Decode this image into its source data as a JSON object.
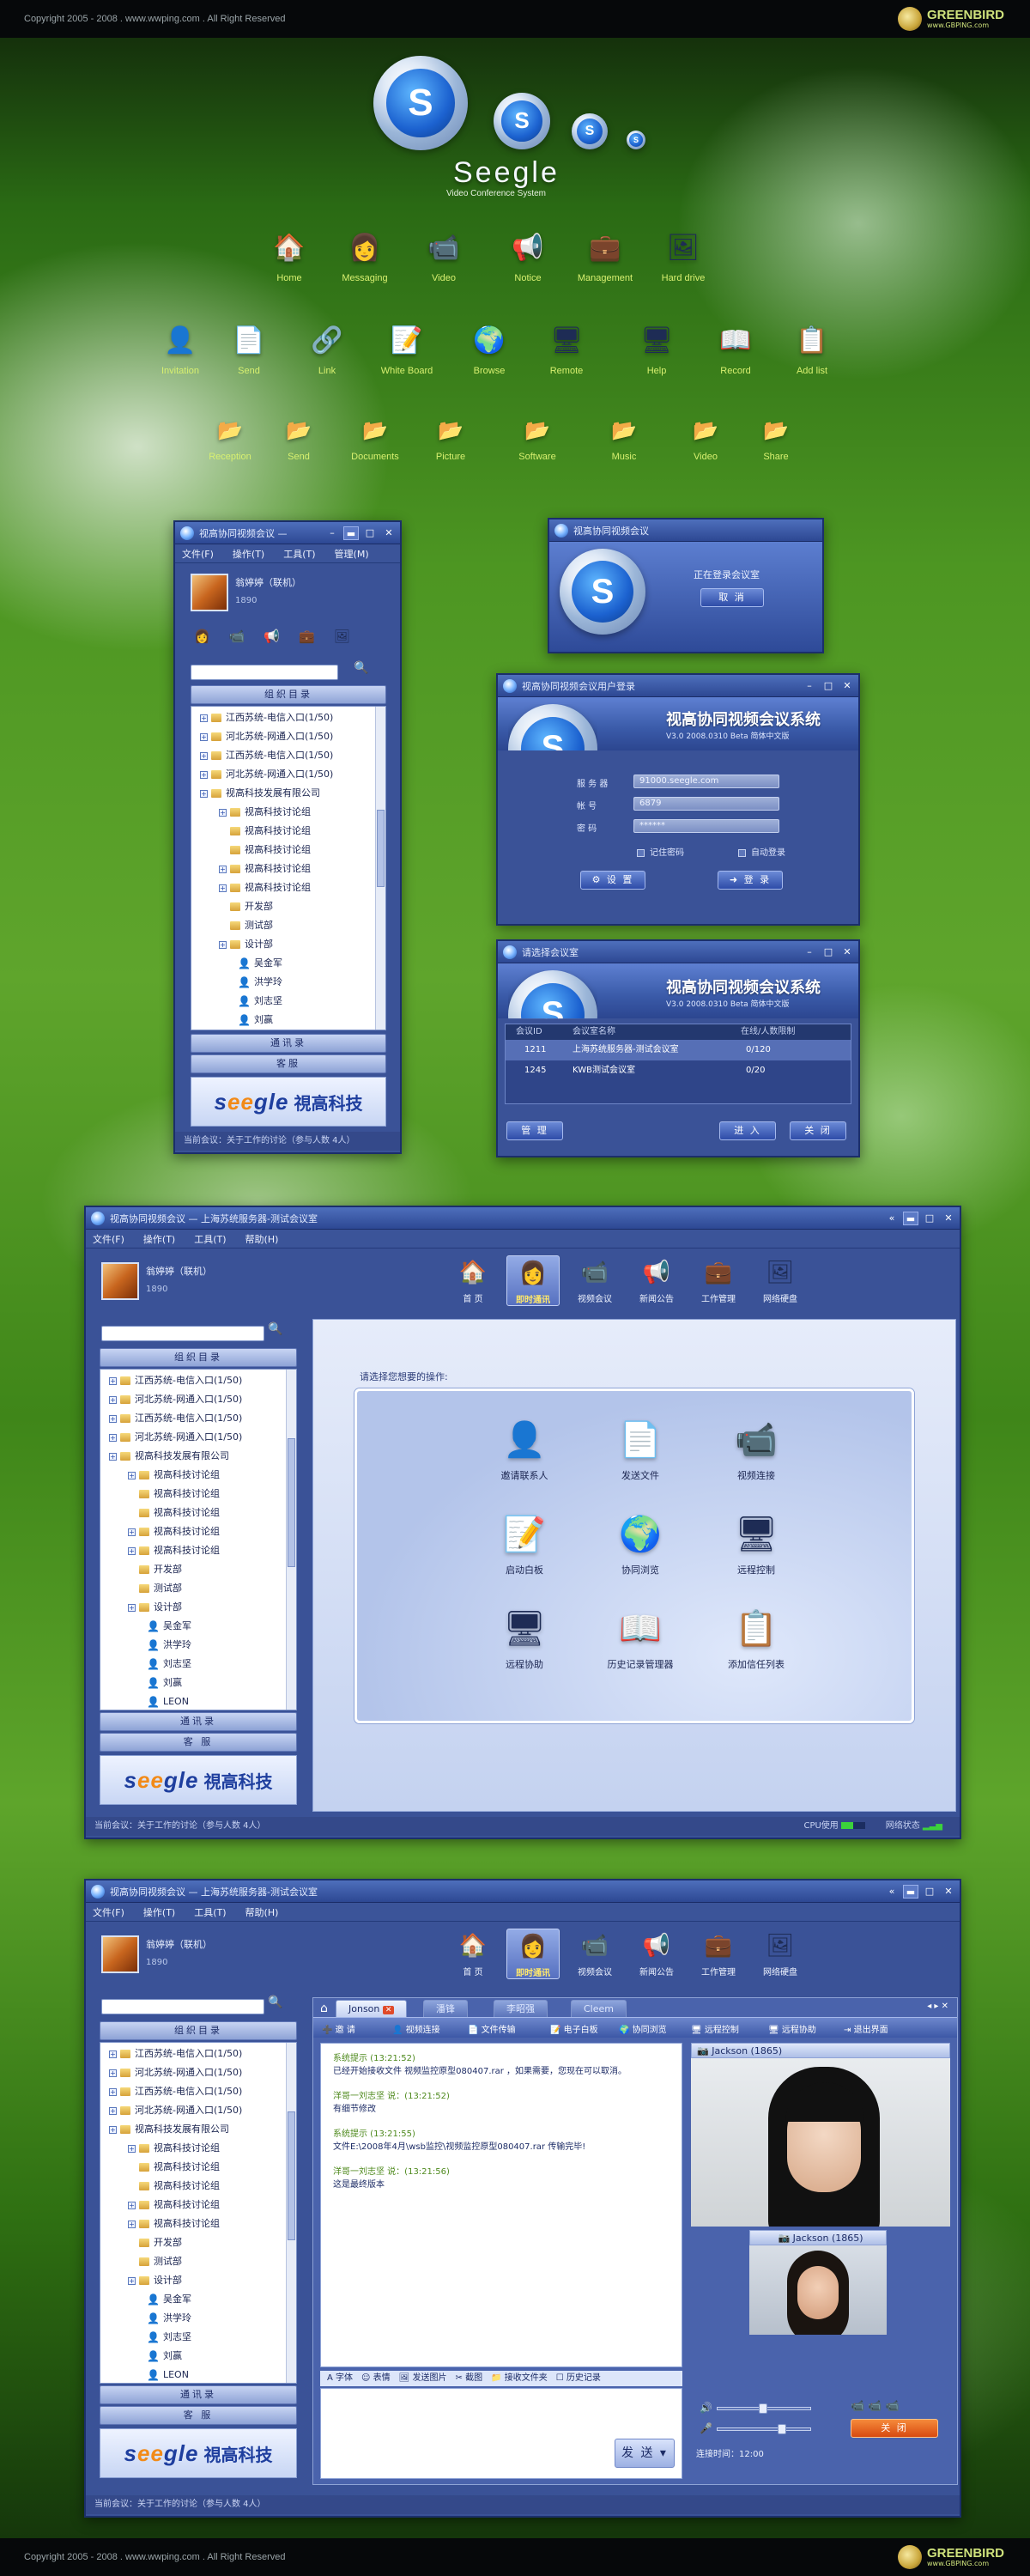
{
  "header": {
    "copyright": "Copyright 2005 - 2008 . www.wwping.com . All Right Reserved",
    "brand_name": "GREENBIRD",
    "brand_sub": "www.GBPING.com"
  },
  "footer": {
    "copyright": "Copyright 2005 - 2008 . www.wwping.com . All Right Reserved",
    "brand_name": "GREENBIRD",
    "brand_sub": "www.GBPING.com"
  },
  "logo": {
    "big_letter": "S",
    "name": "Seegle",
    "subtitle": "Video Conference System"
  },
  "icons_row1": [
    {
      "label": "Home",
      "icon": "home-icon",
      "glyph": "🏠"
    },
    {
      "label": "Messaging",
      "icon": "user-icon",
      "glyph": "👩"
    },
    {
      "label": "Video",
      "icon": "webcam-icon",
      "glyph": "📹"
    },
    {
      "label": "Notice",
      "icon": "megaphone-icon",
      "glyph": "📢"
    },
    {
      "label": "Management",
      "icon": "briefcase-icon",
      "glyph": "💼"
    },
    {
      "label": "Hard drive",
      "icon": "harddrive-icon",
      "glyph": "🖼"
    }
  ],
  "icons_row2": [
    {
      "label": "Invitation",
      "icon": "add-user-icon",
      "glyph": "👤"
    },
    {
      "label": "Send",
      "icon": "send-icon",
      "glyph": "📄"
    },
    {
      "label": "Link",
      "icon": "link-icon",
      "glyph": "🔗"
    },
    {
      "label": "White Board",
      "icon": "whiteboard-icon",
      "glyph": "📝"
    },
    {
      "label": "Browse",
      "icon": "globe-icon",
      "glyph": "🌍"
    },
    {
      "label": "Remote",
      "icon": "remote-icon",
      "glyph": "🖥"
    },
    {
      "label": "Help",
      "icon": "help-icon",
      "glyph": "🖥"
    },
    {
      "label": "Record",
      "icon": "record-icon",
      "glyph": "📖"
    },
    {
      "label": "Add list",
      "icon": "add-list-icon",
      "glyph": "📋"
    }
  ],
  "icons_row3": [
    {
      "label": "Reception",
      "icon": "folder-reception-icon",
      "glyph": "📂"
    },
    {
      "label": "Send",
      "icon": "folder-send-icon",
      "glyph": "📂"
    },
    {
      "label": "Documents",
      "icon": "folder-documents-icon",
      "glyph": "📂"
    },
    {
      "label": "Picture",
      "icon": "folder-picture-icon",
      "glyph": "📂"
    },
    {
      "label": "Software",
      "icon": "folder-software-icon",
      "glyph": "📂"
    },
    {
      "label": "Music",
      "icon": "folder-music-icon",
      "glyph": "📂"
    },
    {
      "label": "Video",
      "icon": "folder-video-icon",
      "glyph": "📂"
    },
    {
      "label": "Share",
      "icon": "folder-share-icon",
      "glyph": "📂"
    }
  ],
  "small_win": {
    "title": "视高协同视频会议 —",
    "menu": [
      "文件(F)",
      "操作(T)",
      "工具(T)",
      "管理(M)"
    ],
    "user_name": "翁婷婷（联机）",
    "user_id": "1890",
    "section": "组织目录",
    "tree": [
      {
        "text": "江西苏统-电信入口(1/50)",
        "lvl": 0,
        "t": "pm"
      },
      {
        "text": "河北苏统-网通入口(1/50)",
        "lvl": 0,
        "t": "pm"
      },
      {
        "text": "江西苏统-电信入口(1/50)",
        "lvl": 0,
        "t": "pm"
      },
      {
        "text": "河北苏统-网通入口(1/50)",
        "lvl": 0,
        "t": "pm"
      },
      {
        "text": "视高科技发展有限公司",
        "lvl": 0,
        "t": "pm"
      },
      {
        "text": "视高科技讨论组",
        "lvl": 1,
        "t": "pm"
      },
      {
        "text": "视高科技讨论组",
        "lvl": 1,
        "t": "f"
      },
      {
        "text": "视高科技讨论组",
        "lvl": 1,
        "t": "f"
      },
      {
        "text": "视高科技讨论组",
        "lvl": 1,
        "t": "pm"
      },
      {
        "text": "视高科技讨论组",
        "lvl": 1,
        "t": "pm"
      },
      {
        "text": "开发部",
        "lvl": 1,
        "t": "f"
      },
      {
        "text": "测试部",
        "lvl": 1,
        "t": "f"
      },
      {
        "text": "设计部",
        "lvl": 1,
        "t": "pm"
      },
      {
        "text": "吴金军",
        "lvl": 2,
        "t": "p"
      },
      {
        "text": "洪学玲",
        "lvl": 2,
        "t": "p"
      },
      {
        "text": "刘志坚",
        "lvl": 2,
        "t": "p"
      },
      {
        "text": "刘赢",
        "lvl": 2,
        "t": "p"
      }
    ],
    "btn1": "通讯录",
    "btn2": "客服",
    "brand_cn": "視高科技",
    "status": "当前会议：关于工作的讨论（参与人数 4人）"
  },
  "login_wait": {
    "title": "视高协同视频会议",
    "text": "正在登录会议室",
    "cancel": "取 消"
  },
  "login": {
    "title": "视高协同视频会议用户登录",
    "banner": "视高协同视频会议系统",
    "version": "V3.0 2008.0310 Beta 简体中文版",
    "server_label": "服 务 器",
    "server_value": "91000.seegle.com",
    "account_label": "帐 号",
    "account_value": "6879",
    "password_label": "密 码",
    "password_value": "******",
    "remember": "记住密码",
    "auto": "自动登录",
    "settings_btn": "设 置",
    "login_btn": "登 录"
  },
  "select_room": {
    "title": "请选择会议室",
    "banner": "视高协同视频会议系统",
    "version": "V3.0 2008.0310 Beta 简体中文版",
    "cols": [
      "会议ID",
      "会议室名称",
      "在线/人数限制"
    ],
    "rows": [
      {
        "id": "1211",
        "name": "上海苏统服务器-测试会议室",
        "count": "0/120"
      },
      {
        "id": "1245",
        "name": "KWB测试会议室",
        "count": "0/20"
      }
    ],
    "manage": "管 理",
    "enter": "进 入",
    "close": "关 闭"
  },
  "main_win": {
    "title": "视高协同视频会议 — 上海苏统服务器-测试会议室",
    "menu": [
      "文件(F)",
      "操作(T)",
      "工具(T)",
      "帮助(H)"
    ],
    "user_name": "翁婷婷（联机）",
    "user_id": "1890",
    "tools": [
      {
        "label": "首 页",
        "glyph": "🏠"
      },
      {
        "label": "即时通讯",
        "glyph": "👩"
      },
      {
        "label": "视频会议",
        "glyph": "📹"
      },
      {
        "label": "新闻公告",
        "glyph": "📢"
      },
      {
        "label": "工作管理",
        "glyph": "💼"
      },
      {
        "label": "网络硬盘",
        "glyph": "🖼"
      }
    ],
    "section": "组织目录",
    "tree": [
      {
        "text": "江西苏统-电信入口(1/50)",
        "lvl": 0,
        "t": "pm"
      },
      {
        "text": "河北苏统-网通入口(1/50)",
        "lvl": 0,
        "t": "pm"
      },
      {
        "text": "江西苏统-电信入口(1/50)",
        "lvl": 0,
        "t": "pm"
      },
      {
        "text": "河北苏统-网通入口(1/50)",
        "lvl": 0,
        "t": "pm"
      },
      {
        "text": "视高科技发展有限公司",
        "lvl": 0,
        "t": "pm"
      },
      {
        "text": "视高科技讨论组",
        "lvl": 1,
        "t": "pm"
      },
      {
        "text": "视高科技讨论组",
        "lvl": 1,
        "t": "f"
      },
      {
        "text": "视高科技讨论组",
        "lvl": 1,
        "t": "f"
      },
      {
        "text": "视高科技讨论组",
        "lvl": 1,
        "t": "pm"
      },
      {
        "text": "视高科技讨论组",
        "lvl": 1,
        "t": "pm"
      },
      {
        "text": "开发部",
        "lvl": 1,
        "t": "f"
      },
      {
        "text": "测试部",
        "lvl": 1,
        "t": "f"
      },
      {
        "text": "设计部",
        "lvl": 1,
        "t": "pm"
      },
      {
        "text": "吴金军",
        "lvl": 2,
        "t": "p"
      },
      {
        "text": "洪学玲",
        "lvl": 2,
        "t": "p"
      },
      {
        "text": "刘志坚",
        "lvl": 2,
        "t": "p"
      },
      {
        "text": "刘赢",
        "lvl": 2,
        "t": "p"
      },
      {
        "text": "LEON",
        "lvl": 2,
        "t": "p"
      }
    ],
    "btn1": "通讯录",
    "btn2": "客 服",
    "brand_cn": "視高科技",
    "prompt": "请选择您想要的操作:",
    "actions": [
      {
        "label": "邀请联系人",
        "glyph": "👤"
      },
      {
        "label": "发送文件",
        "glyph": "📄"
      },
      {
        "label": "视频连接",
        "glyph": "📹"
      },
      {
        "label": "启动白板",
        "glyph": "📝"
      },
      {
        "label": "协同浏览",
        "glyph": "🌍"
      },
      {
        "label": "远程控制",
        "glyph": "🖥"
      },
      {
        "label": "远程协助",
        "glyph": "🖥"
      },
      {
        "label": "历史记录管理器",
        "glyph": "📖"
      },
      {
        "label": "添加信任列表",
        "glyph": "📋"
      }
    ],
    "status": "当前会议：关于工作的讨论（参与人数 4人）",
    "cpu": "CPU使用",
    "net": "网络状态"
  },
  "chat_win": {
    "title": "视高协同视频会议 — 上海苏统服务器-测试会议室",
    "menu": [
      "文件(F)",
      "操作(T)",
      "工具(T)",
      "帮助(H)"
    ],
    "user_name": "翁婷婷（联机）",
    "user_id": "1890",
    "tools": [
      {
        "label": "首 页",
        "glyph": "🏠"
      },
      {
        "label": "即时通讯",
        "glyph": "👩"
      },
      {
        "label": "视频会议",
        "glyph": "📹"
      },
      {
        "label": "新闻公告",
        "glyph": "📢"
      },
      {
        "label": "工作管理",
        "glyph": "💼"
      },
      {
        "label": "网络硬盘",
        "glyph": "🖼"
      }
    ],
    "section": "组织目录",
    "tabs": [
      "Jonson",
      "潘锋",
      "李昭强",
      "Cleem"
    ],
    "chat_tools": [
      "邀 请",
      "视频连接",
      "文件传输",
      "电子白板",
      "协同浏览",
      "远程控制",
      "远程协助",
      "退出界面"
    ],
    "messages": [
      {
        "who": "系统提示 (13:21:52)",
        "text": "已经开始接收文件 视频监控原型080407.rar ，如果需要，您现在可以取消。"
      },
      {
        "who": "洋哥一刘志坚 说：(13:21:52)",
        "text": "有细节修改"
      },
      {
        "who": "系统提示 (13:21:55)",
        "text": "文件E:\\2008年4月\\wsb监控\\视频监控原型080407.rar 传输完毕!"
      },
      {
        "who": "洋哥一刘志坚 说：(13:21:56)",
        "text": "这是最终版本"
      }
    ],
    "bottom_tools": [
      "字体",
      "表情",
      "发送图片",
      "截图",
      "接收文件夹",
      "历史记录"
    ],
    "send": "发 送",
    "video1": "Jackson (1865)",
    "video2": "Jackson (1865)",
    "close": "关 闭",
    "timer": "连接时间：12:00",
    "status": "当前会议：关于工作的讨论（参与人数 4人）",
    "btn1": "通讯录",
    "btn2": "客 服",
    "brand_cn": "視高科技"
  }
}
